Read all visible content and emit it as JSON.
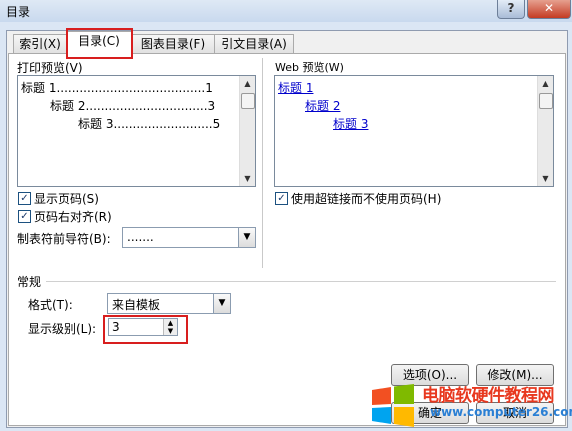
{
  "window": {
    "title": "目录",
    "help_label": "?",
    "close_label": "✕"
  },
  "tabs": [
    {
      "label": "索引(X)",
      "active": false
    },
    {
      "label": "目录(C)",
      "active": true
    },
    {
      "label": "图表目录(F)",
      "active": false
    },
    {
      "label": "引文目录(A)",
      "active": false
    }
  ],
  "print_preview": {
    "label": "打印预览(V)",
    "lines": [
      {
        "text": "标题 1.......................................1"
      },
      {
        "text": "标题 2................................3"
      },
      {
        "text": "标题 3..........................5"
      }
    ]
  },
  "web_preview": {
    "label": "Web 预览(W)",
    "links": [
      "标题 1",
      "标题 2",
      "标题 3"
    ]
  },
  "options": {
    "show_page_numbers": {
      "label": "显示页码(S)",
      "checked": true
    },
    "right_align_page_numbers": {
      "label": "页码右对齐(R)",
      "checked": true
    },
    "use_hyperlinks": {
      "label": "使用超链接而不使用页码(H)",
      "checked": true
    },
    "tab_leader": {
      "label": "制表符前导符(B):",
      "value": "......."
    }
  },
  "general": {
    "group_label": "常规",
    "formats_label": "格式(T):",
    "formats_value": "来自模板",
    "show_levels_label": "显示级别(L):",
    "show_levels_value": "3"
  },
  "buttons": {
    "options": "选项(O)...",
    "modify": "修改(M)...",
    "ok": "确定",
    "cancel": "取消"
  },
  "watermark": {
    "text": "电脑软硬件教程网",
    "url": "www.computer26.com"
  },
  "colors": {
    "red_highlight": "#d81e1e",
    "link_blue": "#0000cc"
  }
}
